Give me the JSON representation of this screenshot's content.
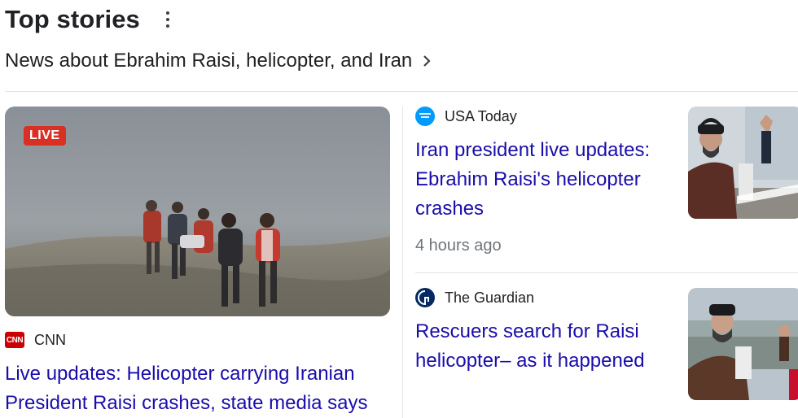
{
  "header": {
    "title": "Top stories",
    "more_icon": "more-vert-icon"
  },
  "subtitle": {
    "text": "News about Ebrahim Raisi, helicopter, and Iran",
    "icon": "chevron-right-icon"
  },
  "main_story": {
    "badge": "LIVE",
    "source": "CNN",
    "source_logo_text": "CNN",
    "headline": "Live updates: Helicopter carrying Iranian President Raisi crashes, state media says",
    "image": "rescuers-in-fog-image"
  },
  "stories": [
    {
      "source": "USA Today",
      "headline": "Iran president live updates: Ebrahim Raisi's helicopter crashes",
      "time": "4 hours ago",
      "thumbnail": "raisi-waving-image"
    },
    {
      "source": "The Guardian",
      "headline": "Rescuers search for Raisi helicopter– as it happened",
      "thumbnail": "raisi-at-dam-image"
    }
  ],
  "colors": {
    "link": "#1a0dab",
    "live_badge": "#d93025",
    "cnn_red": "#cc0000",
    "usa_today_blue": "#009bff",
    "guardian_navy": "#052962"
  }
}
